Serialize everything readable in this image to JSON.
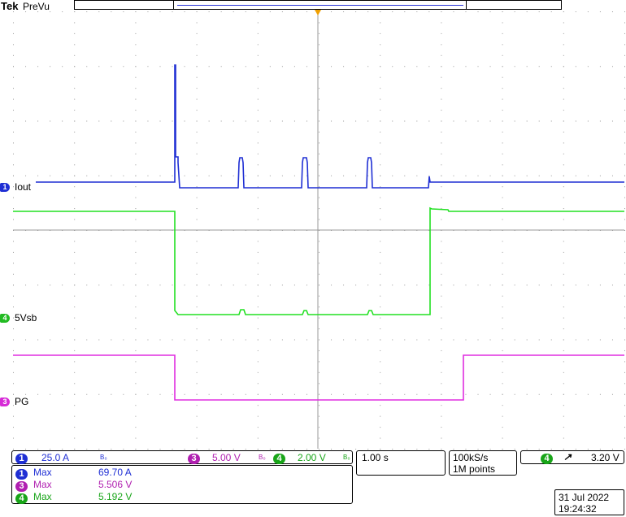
{
  "header": {
    "brand": "Tek",
    "mode": "PreVu"
  },
  "channels": {
    "ch1": {
      "number": "1",
      "label": "Iout",
      "scale": "25.0 A",
      "bw": "B₀",
      "color": "#1f2fd4"
    },
    "ch3": {
      "number": "3",
      "label": "PG",
      "scale": "5.00 V",
      "bw": "B₀",
      "color": "#d62ad6"
    },
    "ch4": {
      "number": "4",
      "label": "5Vsb",
      "scale": "2.00 V",
      "bw": "B₀",
      "color": "#22dd22"
    }
  },
  "timebase": {
    "scale": "1.00 s"
  },
  "acquisition": {
    "rate": "100kS/s",
    "length": "1M points"
  },
  "trigger": {
    "channel": "4",
    "slope": "↗",
    "level": "3.20 V"
  },
  "measurements": [
    {
      "channel": "1",
      "name": "Max",
      "value": "69.70 A",
      "color": "#1f2fd4"
    },
    {
      "channel": "3",
      "name": "Max",
      "value": "5.506 V",
      "color": "#b01fb0"
    },
    {
      "channel": "4",
      "name": "Max",
      "value": "5.192 V",
      "color": "#19a519"
    }
  ],
  "datetime": {
    "date": "31 Jul  2022",
    "time": "19:24:32"
  }
}
